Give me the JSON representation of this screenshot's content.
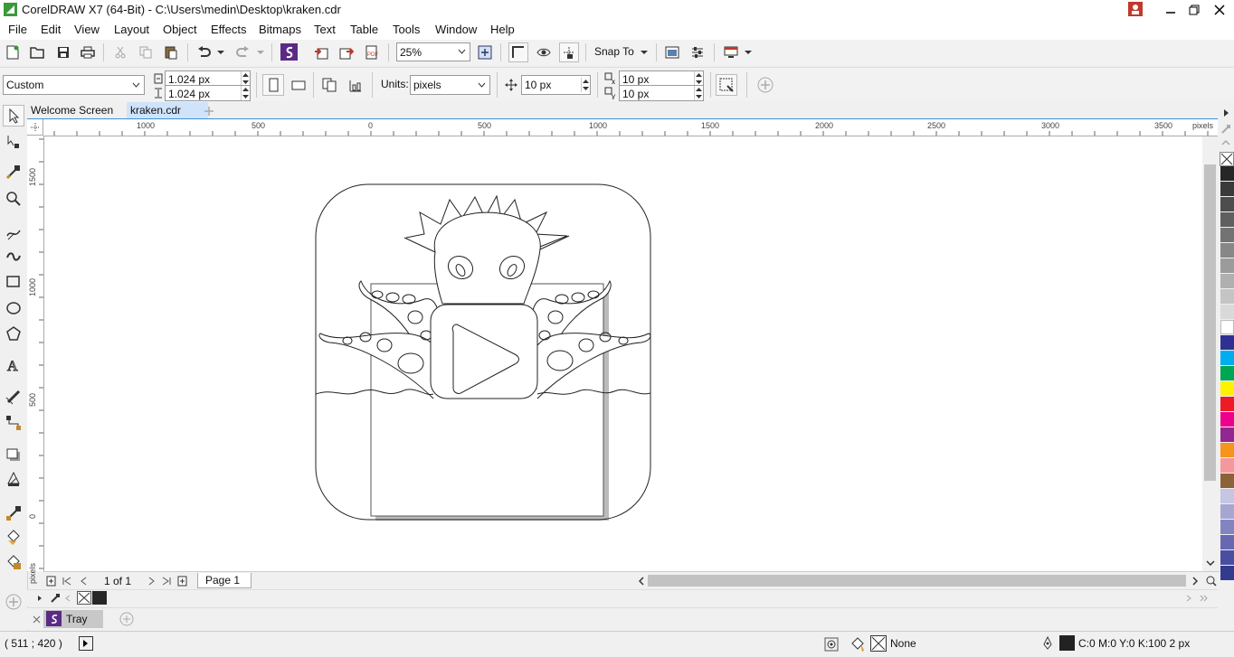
{
  "app": {
    "title": "CorelDRAW X7 (64-Bit) - C:\\Users\\medin\\Desktop\\kraken.cdr"
  },
  "menu": [
    "File",
    "Edit",
    "View",
    "Layout",
    "Object",
    "Effects",
    "Bitmaps",
    "Text",
    "Table",
    "Tools",
    "Window",
    "Help"
  ],
  "toolbar": {
    "zoom": "25%",
    "snap_to": "Snap To"
  },
  "propbar": {
    "preset": "Custom",
    "width": "1.024 px",
    "height": "1.024 px",
    "units_label": "Units:",
    "units_value": "pixels",
    "nudge": "10 px",
    "dup_x": "10 px",
    "dup_y": "10 px"
  },
  "tabs": [
    {
      "label": "Welcome Screen",
      "active": false
    },
    {
      "label": "kraken.cdr",
      "active": true
    }
  ],
  "hruler": {
    "labels": [
      "1000",
      "500",
      "0",
      "500",
      "1000",
      "1500",
      "2000",
      "2500",
      "3000",
      "3500"
    ],
    "unit": "pixels"
  },
  "vruler": {
    "labels": [
      "1500",
      "1000",
      "500",
      "0"
    ],
    "unit": "pixels"
  },
  "pagenav": {
    "page_count": "1 of 1",
    "page_tab": "Page 1"
  },
  "tray": {
    "label": "Tray"
  },
  "status": {
    "coords": "( 511  ; 420  )",
    "fill": "None",
    "outline": "C:0 M:0 Y:0 K:100  2 px"
  },
  "palette_colors": [
    "#262626",
    "#3a3a3a",
    "#4d4d4d",
    "#5f5f5f",
    "#737373",
    "#878787",
    "#9b9b9b",
    "#b0b0b0",
    "#c4c4c4",
    "#d9d9d9",
    "#ffffff",
    "#2e3192",
    "#00aeef",
    "#00a651",
    "#fff200",
    "#ed1c24",
    "#ec008c",
    "#92278f",
    "#f7941d",
    "#f5989d",
    "#8c6239",
    "#c4c6e3",
    "#a5a7d1",
    "#8284c0",
    "#6669b0",
    "#4a4ea1",
    "#333b8f"
  ]
}
